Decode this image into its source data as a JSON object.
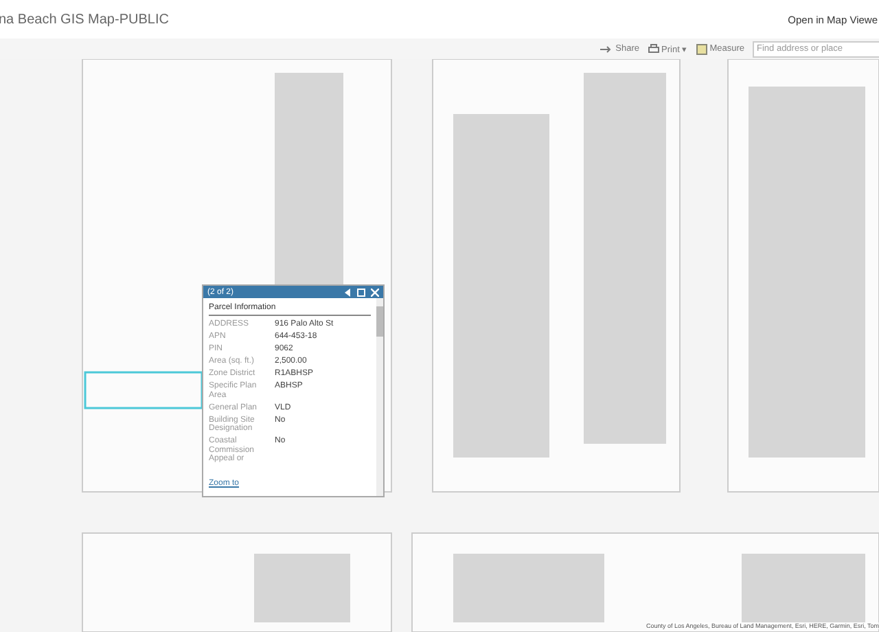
{
  "header": {
    "title": "na Beach GIS Map-PUBLIC",
    "open_link": "Open in Map Viewe"
  },
  "toolbar": {
    "buttons": [
      {
        "kind": "share",
        "label": "Share"
      },
      {
        "kind": "print",
        "label": "Print ▾"
      },
      {
        "kind": "measure",
        "label": "Measure"
      }
    ],
    "search": {
      "placeholder": "Find address or place"
    }
  },
  "map": {
    "attribution": "County of Los Angeles, Bureau of Land Management, Esri, HERE, Garmin, Esri, Tom"
  },
  "popup": {
    "title": "(2 of 2)",
    "section": "Parcel Information",
    "rows": [
      {
        "label": "ADDRESS",
        "value": "916 Palo Alto St"
      },
      {
        "label": "APN",
        "value": "644-453-18"
      },
      {
        "label": "PIN",
        "value": "9062"
      },
      {
        "label": "Area (sq. ft.)",
        "value": "2,500.00"
      },
      {
        "label": "Zone District",
        "value": "R1ABHSP"
      },
      {
        "label": "Specific Plan Area",
        "value": "ABHSP"
      },
      {
        "label": "General Plan",
        "value": "VLD"
      },
      {
        "label": "Building Site Designation",
        "value": "No"
      },
      {
        "label": "Coastal Commission Appeal or",
        "value": "No"
      }
    ],
    "link": "Zoom to"
  }
}
